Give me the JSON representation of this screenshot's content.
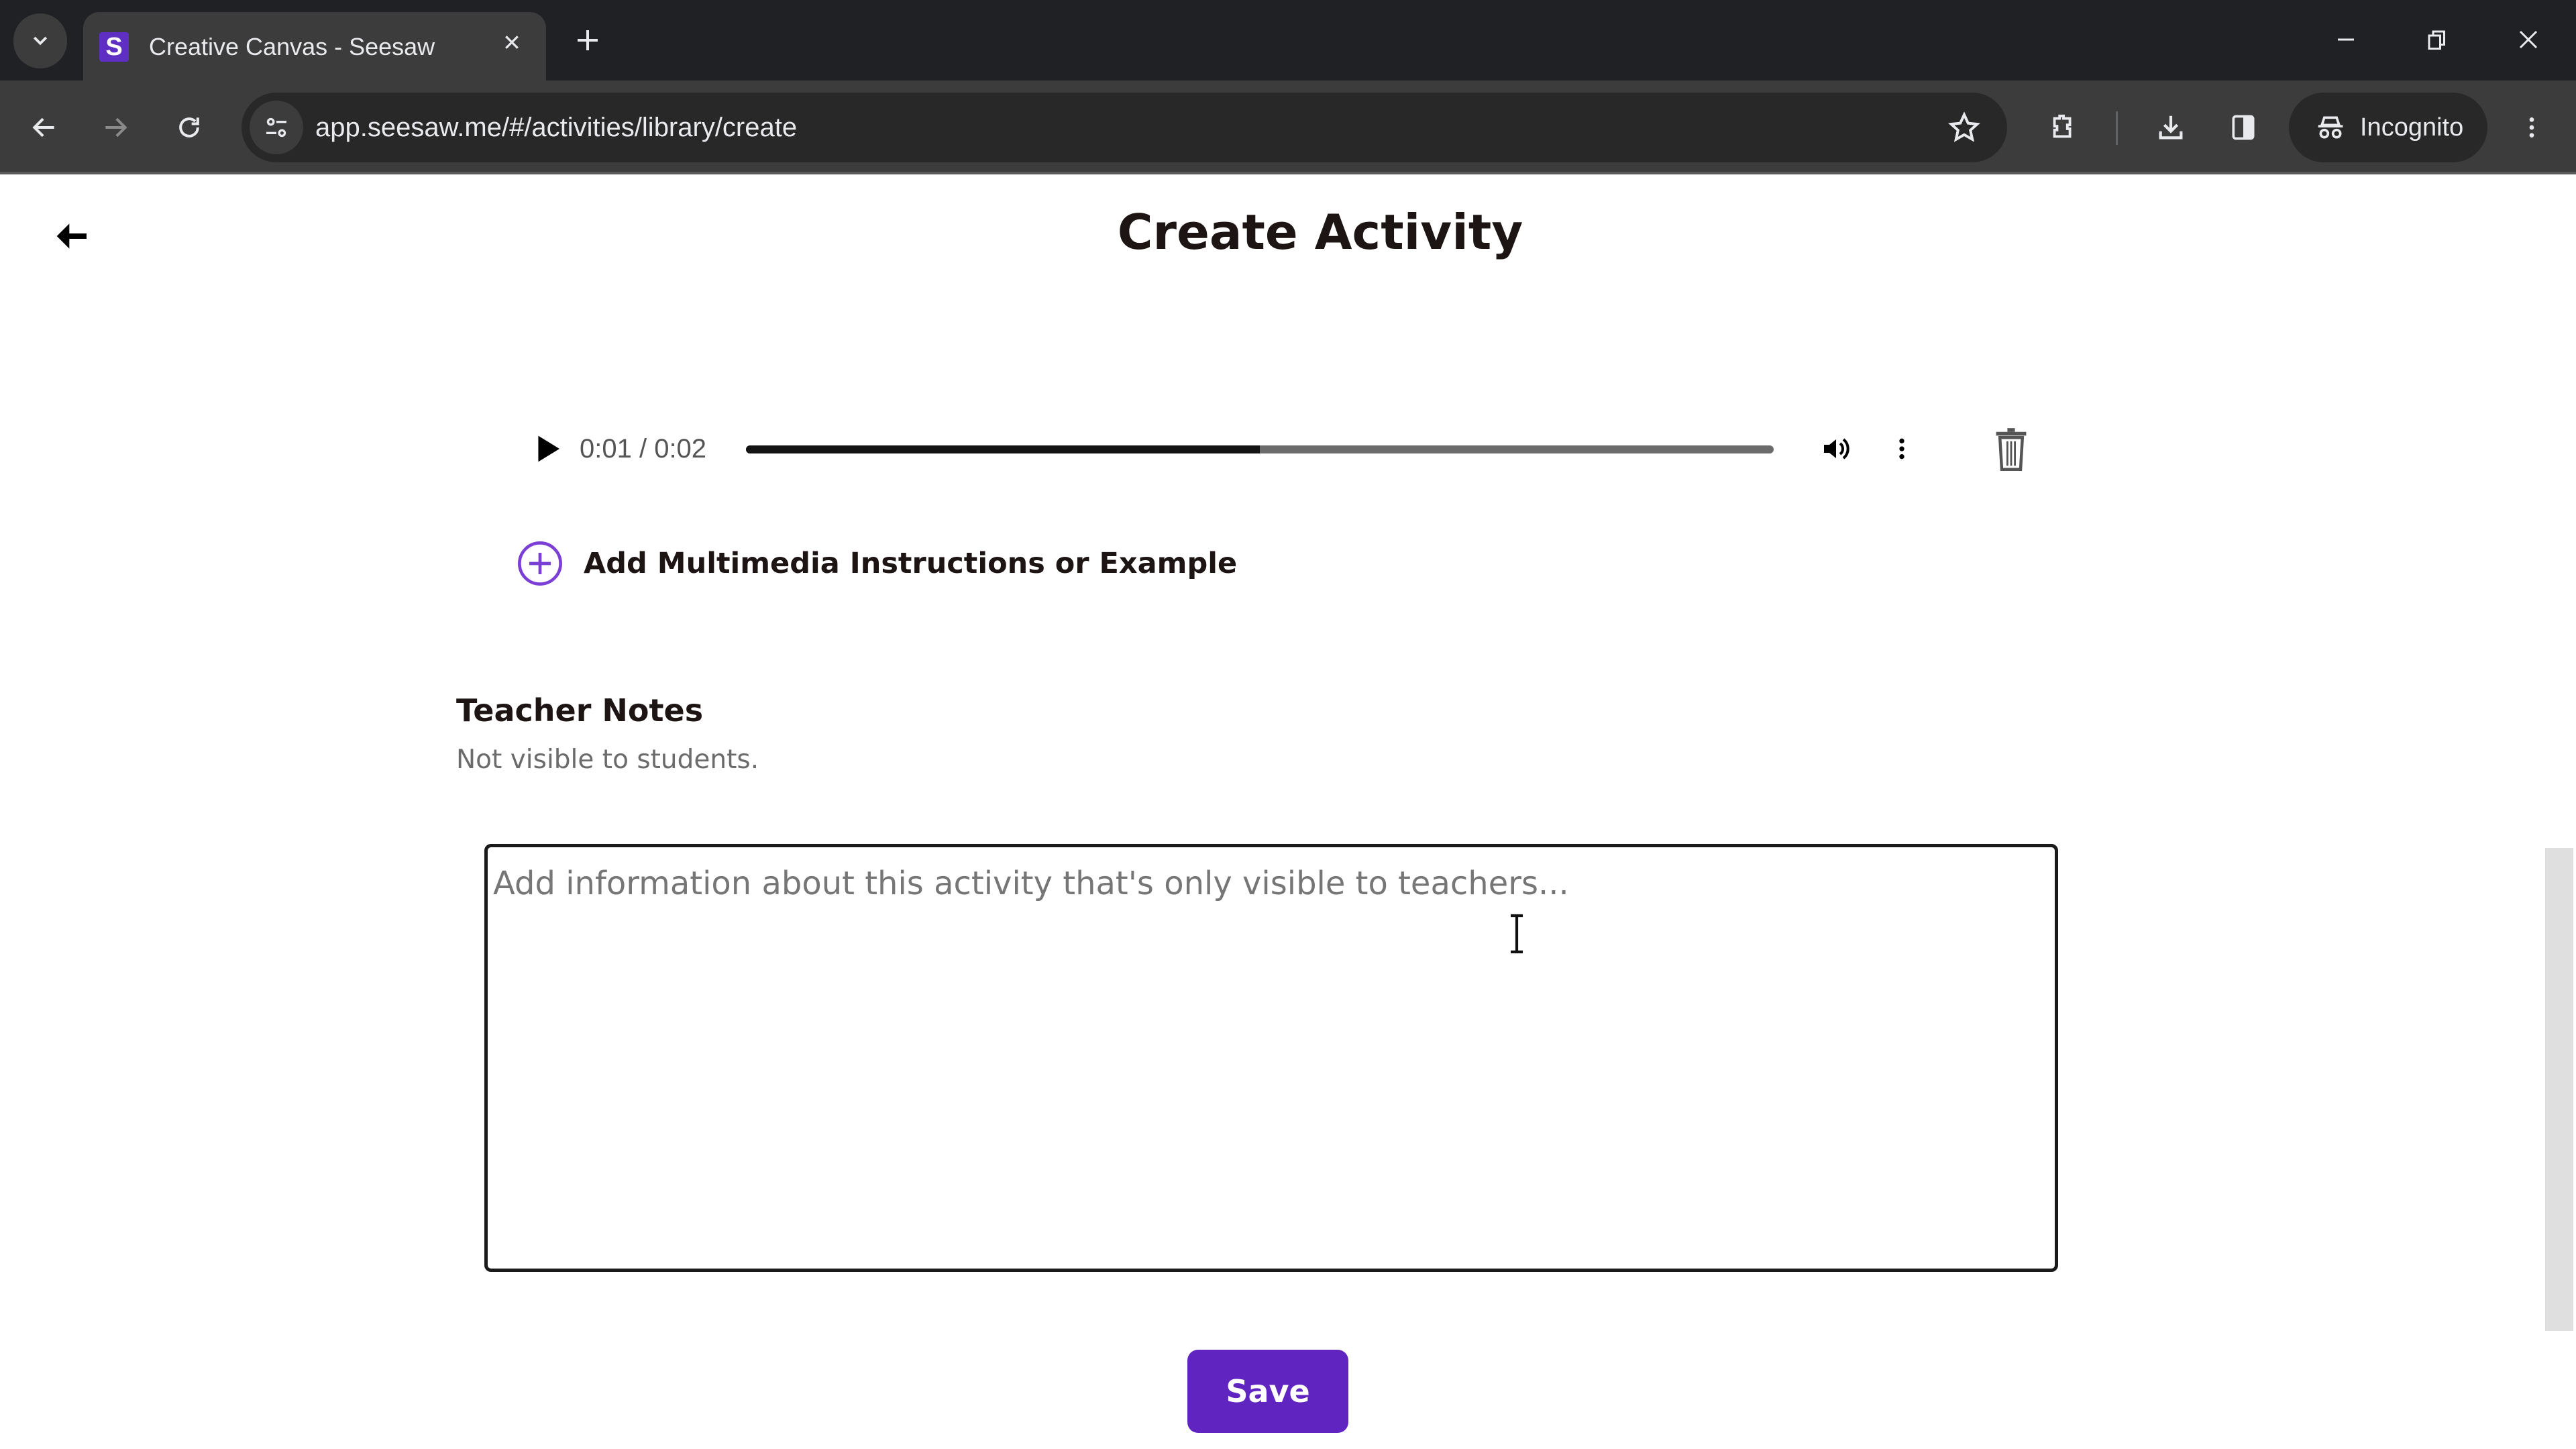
{
  "browser": {
    "tab_title": "Creative Canvas - Seesaw",
    "favicon_letter": "S",
    "url": "app.seesaw.me/#/activities/library/create",
    "incognito_label": "Incognito",
    "brand_color": "#5f2ec2"
  },
  "page": {
    "title": "Create Activity",
    "audio": {
      "current_time": "0:01",
      "duration": "0:02",
      "time_display": "0:01 / 0:02",
      "progress": 0.5
    },
    "add_media_label": "Add Multimedia Instructions or Example",
    "teacher_notes": {
      "heading": "Teacher Notes",
      "subtext": "Not visible to students.",
      "value": "",
      "placeholder": "Add information about this activity that's only visible to teachers..."
    },
    "save_label": "Save",
    "accent_color": "#6025c0"
  },
  "icons": {
    "back": "arrow-left-icon",
    "play": "play-icon",
    "volume": "volume-icon",
    "more": "more-vertical-icon",
    "trash": "trash-icon",
    "add": "plus-circle-icon"
  }
}
